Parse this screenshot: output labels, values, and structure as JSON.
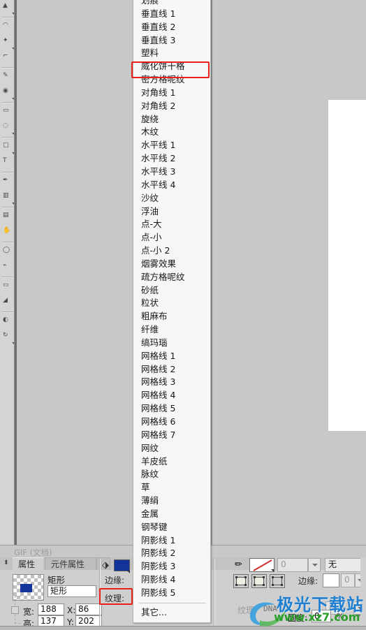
{
  "app": {
    "document_status": "GIF (文档)"
  },
  "texture_menu": {
    "name": "纹理下拉菜单",
    "items": [
      {
        "label": "划痕"
      },
      {
        "label": "垂直线 1"
      },
      {
        "label": "垂直线 2"
      },
      {
        "label": "垂直线 3"
      },
      {
        "label": "塑料"
      },
      {
        "label": "威化饼干格",
        "highlighted": true
      },
      {
        "label": "密方格呢纹"
      },
      {
        "label": "对角线 1"
      },
      {
        "label": "对角线 2"
      },
      {
        "label": "旋绕"
      },
      {
        "label": "木纹"
      },
      {
        "label": "水平线 1"
      },
      {
        "label": "水平线 2"
      },
      {
        "label": "水平线 3"
      },
      {
        "label": "水平线 4"
      },
      {
        "label": "沙纹"
      },
      {
        "label": "浮油"
      },
      {
        "label": "点-大"
      },
      {
        "label": "点-小"
      },
      {
        "label": "点-小 2"
      },
      {
        "label": "烟雾效果"
      },
      {
        "label": "疏方格呢纹"
      },
      {
        "label": "砂纸"
      },
      {
        "label": "粒状"
      },
      {
        "label": "粗麻布"
      },
      {
        "label": "纤维"
      },
      {
        "label": "缟玛瑙"
      },
      {
        "label": "网格线 1"
      },
      {
        "label": "网格线 2"
      },
      {
        "label": "网格线 3"
      },
      {
        "label": "网格线 4"
      },
      {
        "label": "网格线 5"
      },
      {
        "label": "网格线 6"
      },
      {
        "label": "网格线 7"
      },
      {
        "label": "网纹"
      },
      {
        "label": "羊皮纸"
      },
      {
        "label": "脉纹"
      },
      {
        "label": "草"
      },
      {
        "label": "薄绢"
      },
      {
        "label": "金属"
      },
      {
        "label": "钢琴键"
      },
      {
        "label": "阴影线 1"
      },
      {
        "label": "阴影线 2"
      },
      {
        "label": "阴影线 3"
      },
      {
        "label": "阴影线 4"
      },
      {
        "label": "阴影线 5"
      },
      {
        "separator": true
      },
      {
        "label": "其它..."
      }
    ]
  },
  "properties_panel": {
    "tabs": [
      {
        "label": "属性",
        "active": true
      },
      {
        "label": "元件属性",
        "active": false
      }
    ],
    "object": {
      "type_label": "矩形",
      "name_value": "矩形",
      "swatch_color": "#12349a"
    },
    "geometry": {
      "width_label": "宽:",
      "width_value": "188",
      "height_label": "高:",
      "height_value": "137",
      "x_label": "X:",
      "x_value": "86",
      "y_label": "Y:",
      "y_value": "202"
    },
    "fill": {
      "color": "#12349a",
      "edge_label": "边缘:",
      "texture_label": "纹理:",
      "texture_highlighted": true
    },
    "stroke": {
      "width_value": "0",
      "style_value": "无",
      "edge_label": "边缘:",
      "edge_value": "0",
      "texture_label": "纹理:",
      "texture_value": "DNA",
      "texture_amount": "0",
      "roundness_label": "圆度:",
      "roundness_value": "0",
      "percent_sign": "%"
    }
  },
  "watermark": {
    "brand": "极光下载站",
    "url": "www.xz7.com"
  },
  "colors": {
    "accent_red": "#e8201a",
    "fill_blue": "#12349a",
    "panel_bg": "#cfcfcf",
    "canvas_bg": "#c8c8c8",
    "menu_bg": "#f7f7f7"
  }
}
